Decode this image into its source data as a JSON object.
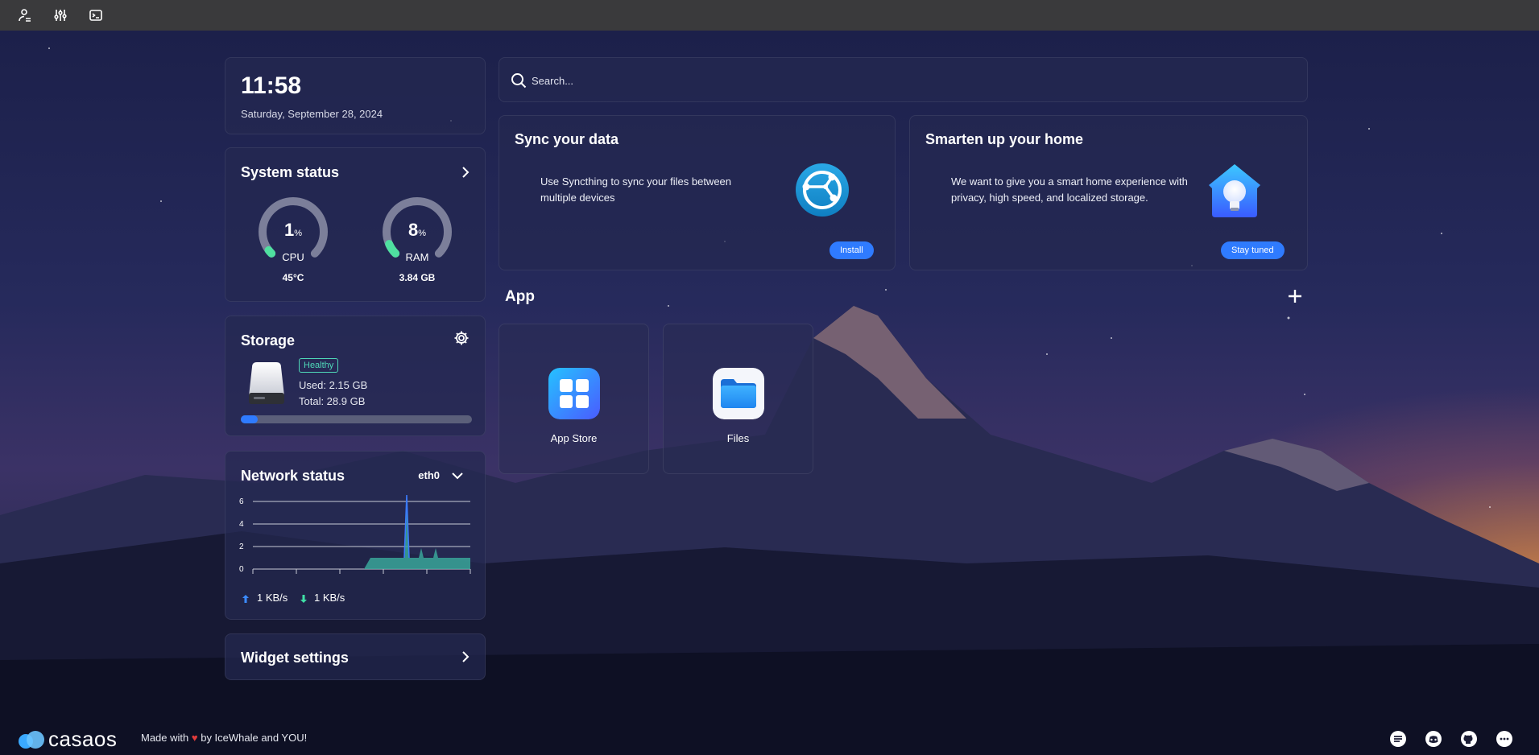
{
  "widgets": {
    "clock": {
      "time": "11:58",
      "date": "Saturday, September 28, 2024"
    },
    "system": {
      "title": "System status",
      "cpu": {
        "value": 1,
        "value_text": "1",
        "unit": "%",
        "label": "CPU",
        "sub": "45°C"
      },
      "ram": {
        "value": 8,
        "value_text": "8",
        "unit": "%",
        "label": "RAM",
        "sub": "3.84 GB"
      }
    },
    "storage": {
      "title": "Storage",
      "health": "Healthy",
      "used": "Used: 2.15 GB",
      "total": "Total: 28.9 GB",
      "used_fraction": 0.0744
    },
    "network": {
      "title": "Network status",
      "interface": "eth0",
      "y_ticks": [
        "6",
        "4",
        "2",
        "0"
      ],
      "upload": "1 KB/s",
      "download": "1 KB/s"
    },
    "settings": {
      "title": "Widget settings"
    }
  },
  "search": {
    "placeholder": "Search..."
  },
  "promos": [
    {
      "title": "Sync your data",
      "text": "Use Syncthing to sync your files between multiple devices",
      "button": "Install"
    },
    {
      "title": "Smarten up your home",
      "text": "We want to give you a smart home experience with privacy, high speed, and localized storage.",
      "button": "Stay tuned"
    }
  ],
  "apps": {
    "title": "App",
    "items": [
      {
        "name": "App Store",
        "icon": "app-store-icon"
      },
      {
        "name": "Files",
        "icon": "folder-icon"
      }
    ]
  },
  "footer": {
    "brand": "casaos",
    "made_prefix": "Made with",
    "made_suffix": "by IceWhale and YOU!"
  },
  "colors": {
    "accent": "#2f7bff",
    "gauge_fill": "#4fe0a0",
    "healthy": "#4fd8b8",
    "net_area": "#3aa69a"
  }
}
